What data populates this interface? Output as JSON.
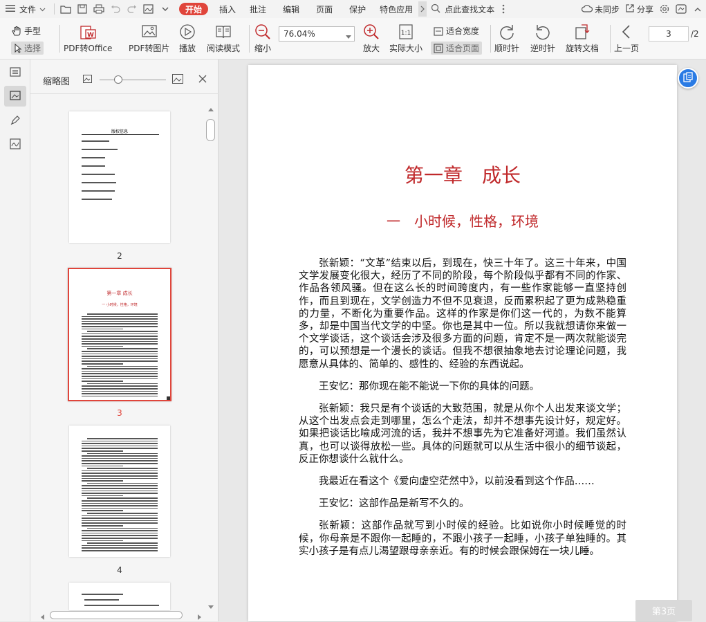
{
  "menubar": {
    "file": "文件",
    "start": "开始",
    "tabs": [
      "插入",
      "批注",
      "编辑",
      "页面",
      "保护",
      "特色应用"
    ],
    "search": "点此查找文本",
    "sync": "未同步",
    "share": "分享"
  },
  "toolbar": {
    "hand": "手型",
    "select": "选择",
    "pdf_office": "PDF转Office",
    "pdf_image": "PDF转图片",
    "play": "播放",
    "read_mode": "阅读模式",
    "zoom_out": "缩小",
    "zoom_value": "76.04%",
    "zoom_in": "放大",
    "actual_size": "实际大小",
    "fit_width": "适合宽度",
    "fit_page": "适合页面",
    "cw": "顺时针",
    "ccw": "逆时针",
    "rotate": "旋转文档",
    "prev_page": "上一页",
    "page_current": "3",
    "page_total": "/2"
  },
  "thumbs": {
    "title": "缩略图",
    "pages": [
      {
        "num": "2",
        "title": "版权信息"
      },
      {
        "num": "3",
        "title": "第一章  成长",
        "subtitle": "一  小时候，性格，环境"
      },
      {
        "num": "4"
      }
    ]
  },
  "page": {
    "chapter_title": "第一章　成长",
    "section_title": "一　小时候，性格，环境",
    "paragraphs": [
      "张新颖：“文革”结束以后，到现在，快三十年了。这三十年来，中国文学发展变化很大，经历了不同的阶段，每个阶段似乎都有不同的作家、作品各领风骚。但在这么长的时间跨度内，有一些作家能够一直坚持创作，而且到现在，文学创造力不但不见衰退，反而累积起了更为成熟稳重的力量，不断化为重要作品。这样的作家是你们这一代的，为数不能算多，却是中国当代文学的中坚。你也是其中一位。所以我就想请你来做一个文学谈话，这个谈话会涉及很多方面的问题，肯定不是一两次就能谈完的，可以预想是一个漫长的谈话。但我不想很抽象地去讨论理论问题，我愿意从具体的、简单的、感性的、经验的东西说起。",
      "王安忆：那你现在能不能说一下你的具体的问题。",
      "张新颖：我只是有个谈话的大致范围，就是从你个人出发来谈文学；从这个出发点会走到哪里，怎么个走法，却并不想事先设计好，规定好。如果把谈话比喻成河流的话，我并不想事先为它准备好河道。我们虽然认真，也可以谈得放松一些。具体的问题就可以从生活中很小的细节谈起，反正你想谈什么就什么。",
      "我最近在看这个《爱向虚空茫然中》，以前没看到这个作品……",
      "王安忆：这部作品是新写不久的。",
      "张新颖：这部作品就写到小时候的经验。比如说你小时候睡觉的时候，你母亲是不跟你一起睡的，不跟小孩子一起睡，小孩子单独睡的。其实小孩子是有点儿渴望跟母亲亲近。有的时候会跟保姆在一块儿睡。"
    ],
    "badge": "第3页"
  },
  "colors": {
    "accent": "#e0453b",
    "title_red": "#c0292b"
  }
}
